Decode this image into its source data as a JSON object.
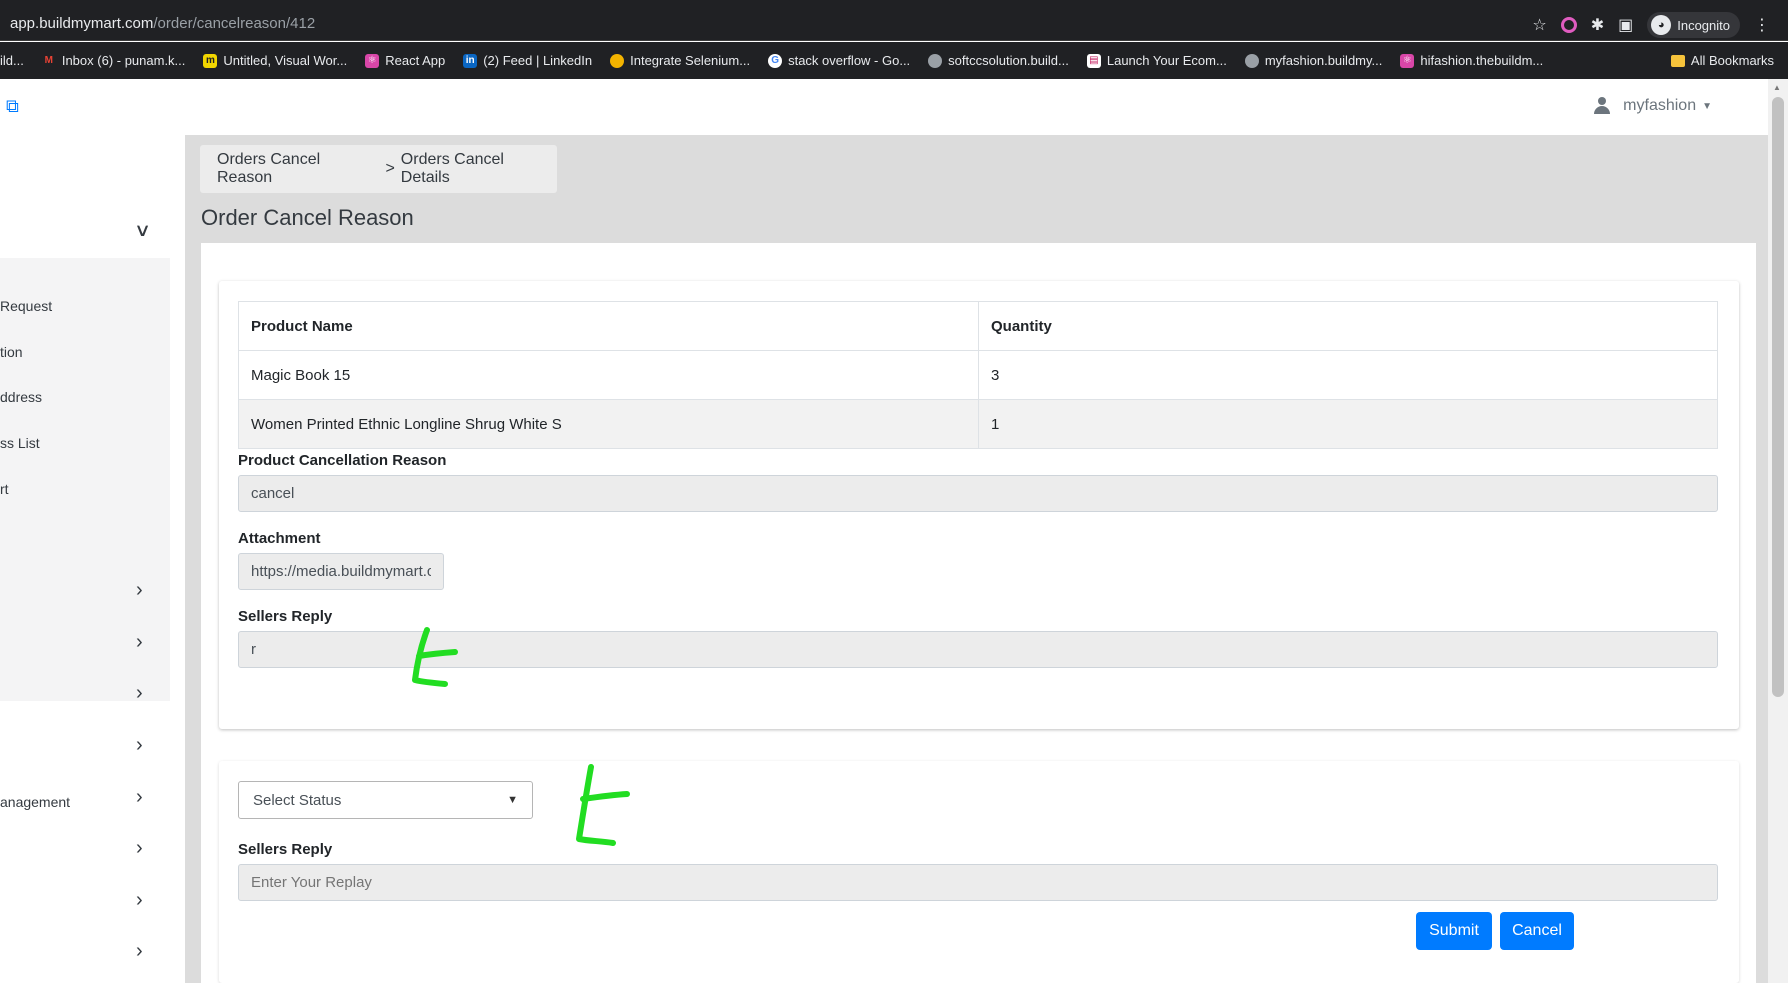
{
  "browser": {
    "url_host": "app.buildmymart.com",
    "url_path": "/order/cancelreason/412",
    "incognito_label": "Incognito",
    "bookmarks": [
      {
        "label": "ild...",
        "icon": "page-icon",
        "color": "#5f6368"
      },
      {
        "label": "Inbox (6) - punam.k...",
        "icon": "gmail-icon",
        "color": "#ea4335"
      },
      {
        "label": "Untitled, Visual Wor...",
        "icon": "miro-icon",
        "color": "#f2d600"
      },
      {
        "label": "React App",
        "icon": "react-icon",
        "color": "#d946a8"
      },
      {
        "label": "(2) Feed | LinkedIn",
        "icon": "linkedin-icon",
        "color": "#0a66c2"
      },
      {
        "label": "Integrate Selenium...",
        "icon": "selenium-icon",
        "color": "#f4b400"
      },
      {
        "label": "stack overflow - Go...",
        "icon": "google-icon",
        "color": "#ffffff"
      },
      {
        "label": "softccsolution.build...",
        "icon": "globe-icon",
        "color": "#9aa0a6"
      },
      {
        "label": "Launch Your Ecom...",
        "icon": "store-icon",
        "color": "#c2185b"
      },
      {
        "label": "myfashion.buildmy...",
        "icon": "globe-icon",
        "color": "#9aa0a6"
      },
      {
        "label": "hifashion.thebuildm...",
        "icon": "react-icon",
        "color": "#d946a8"
      }
    ],
    "all_bookmarks_label": "All Bookmarks"
  },
  "header": {
    "username": "myfashion"
  },
  "sidebar": {
    "items": [
      {
        "label": "Request"
      },
      {
        "label": "tion"
      },
      {
        "label": "ddress"
      },
      {
        "label": "ss List"
      },
      {
        "label": "rt"
      },
      {
        "label": ""
      },
      {
        "label": ""
      },
      {
        "label": ""
      },
      {
        "label": ""
      },
      {
        "label": "anagement"
      },
      {
        "label": ""
      },
      {
        "label": ""
      },
      {
        "label": ""
      }
    ]
  },
  "main": {
    "breadcrumb": {
      "first": "Orders Cancel Reason",
      "sep": ">",
      "second": "Orders Cancel Details"
    },
    "title": "Order Cancel Reason",
    "table": {
      "headers": [
        "Product Name",
        "Quantity"
      ],
      "rows": [
        [
          "Magic Book 15",
          "3"
        ],
        [
          "Women Printed Ethnic Longline Shrug White S",
          "1"
        ]
      ]
    },
    "cancellation_reason": {
      "label": "Product Cancellation Reason",
      "value": "cancel"
    },
    "attachment": {
      "label": "Attachment",
      "value": "https://media.buildmymart.com"
    },
    "sellers_reply_readonly": {
      "label": "Sellers Reply",
      "value": "r"
    },
    "status_select": {
      "selected": "Select Status"
    },
    "sellers_reply_input": {
      "label": "Sellers Reply",
      "placeholder": "Enter Your Replay"
    },
    "buttons": {
      "submit": "Submit",
      "cancel": "Cancel"
    }
  },
  "colors": {
    "primary": "#007bff",
    "annotation": "#22dd22"
  }
}
